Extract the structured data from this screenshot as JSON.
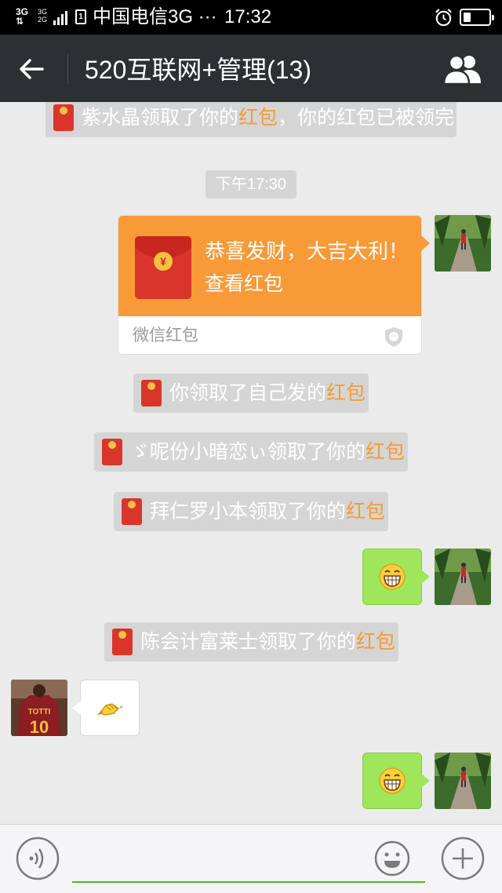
{
  "status_bar": {
    "network_type": "3G",
    "sim_network": "3G",
    "sim_network_2": "2G",
    "sim_badge": "1",
    "carrier": "中国电信3G ···",
    "time": "17:32",
    "icons": [
      "alarm-icon",
      "battery-icon",
      "signal-icon"
    ]
  },
  "header": {
    "title": "520互联网+管理(13)",
    "icons": [
      "back-arrow-icon",
      "group-members-icon"
    ],
    "bg_color": "#2d3033"
  },
  "messages": {
    "notice_top": {
      "prefix": "紫水晶领取了你的",
      "highlight": "红包",
      "suffix": "，你的红包已被领完"
    },
    "timestamp": "下午17:30",
    "red_packet": {
      "greeting": "恭喜发财，大吉大利！",
      "action": "查看红包",
      "label": "微信红包",
      "coin": "¥"
    },
    "notice_1": {
      "prefix": "你领取了自己发的",
      "highlight": "红包"
    },
    "notice_2": {
      "prefix": "ゞ呢份小暗恋ぃ领取了你的",
      "highlight": "红包"
    },
    "notice_3": {
      "prefix": "拜仁罗小本领取了你的",
      "highlight": "红包"
    },
    "notice_4": {
      "prefix": "陈会计富莱士领取了你的",
      "highlight": "红包"
    },
    "emoji_messages": [
      "grin-emoji",
      "shake-hands-emoji",
      "grin-emoji"
    ],
    "other_avatar_text": {
      "name": "TOTTI",
      "number": "10"
    }
  },
  "input_bar": {
    "placeholder": "",
    "icons": [
      "voice-icon",
      "emoji-icon",
      "plus-icon"
    ]
  },
  "colors": {
    "accent_green": "#45c01a",
    "red_packet_orange": "#f89a38",
    "highlight_orange": "#f39c35",
    "bubble_green": "#9fe65b"
  }
}
